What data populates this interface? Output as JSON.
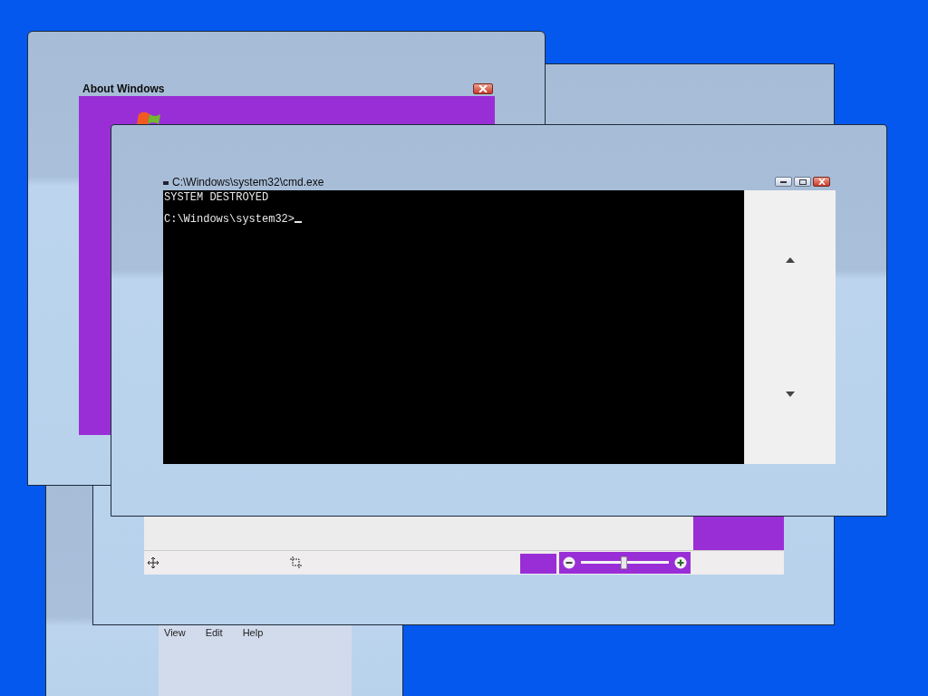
{
  "about_window": {
    "title": "About Windows"
  },
  "cmd_window": {
    "title": "C:\\Windows\\system32\\cmd.exe",
    "lines": [
      "SYSTEM DESTROYED",
      "C:\\Windows\\system32>"
    ]
  },
  "viewer_window": {
    "zoom_slider": {
      "level": 0.48
    }
  },
  "back_window": {
    "menu": [
      "View",
      "Edit",
      "Help"
    ]
  }
}
